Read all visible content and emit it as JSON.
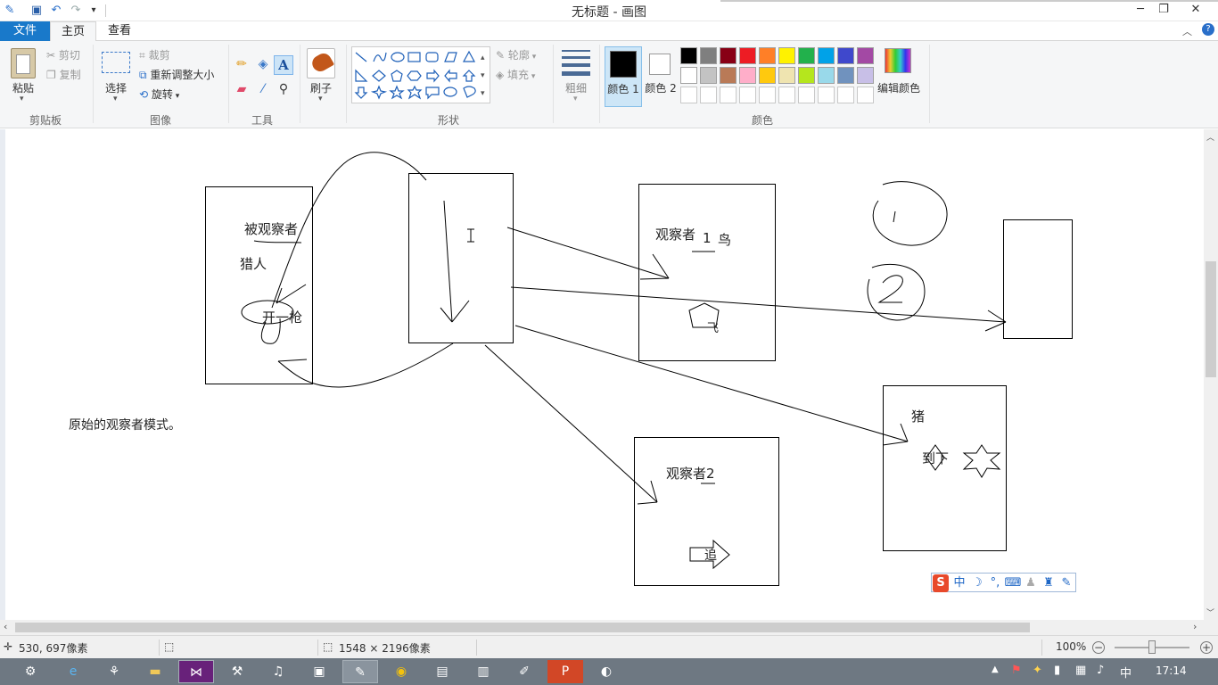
{
  "window": {
    "title": "无标题 - 画图",
    "minimize": "─",
    "restore": "❐",
    "close": "✕"
  },
  "quick_access": [
    "save-icon",
    "undo-icon",
    "redo-icon",
    "customize-icon"
  ],
  "tabs": [
    {
      "label": "文件",
      "active": false
    },
    {
      "label": "主页",
      "active": true
    },
    {
      "label": "查看",
      "active": false
    }
  ],
  "ribbon": {
    "clipboard": {
      "paste": "粘贴",
      "cut": "剪切",
      "copy": "复制",
      "label": "剪贴板"
    },
    "image": {
      "select": "选择",
      "crop": "裁剪",
      "resize": "重新调整大小",
      "rotate": "旋转",
      "label": "图像"
    },
    "tools": {
      "label": "工具"
    },
    "brushes": {
      "label": "刷子"
    },
    "shapes": {
      "outline": "轮廓",
      "fill": "填充",
      "label": "形状"
    },
    "size": {
      "label": "粗细"
    },
    "colors": {
      "color1": "颜色 1",
      "color2": "颜色 2",
      "edit": "编辑颜色",
      "label": "颜色",
      "row1": [
        "#000000",
        "#7f7f7f",
        "#880015",
        "#ed1c24",
        "#ff7f27",
        "#fff200",
        "#22b14c",
        "#00a2e8",
        "#3f48cc",
        "#a349a4"
      ],
      "row2": [
        "#ffffff",
        "#c3c3c3",
        "#b97a57",
        "#ffaec9",
        "#ffc90e",
        "#efe4b0",
        "#b5e61d",
        "#99d9ea",
        "#7092be",
        "#c8bfe7"
      ]
    }
  },
  "canvas": {
    "observed": "被观察者",
    "hunter": "猎人",
    "fire": "开一枪",
    "observer1": "观察者",
    "bird_num": "1",
    "bird": "鸟",
    "fly": "飞",
    "observer2": "观察者2",
    "chase": "追",
    "pig": "猪",
    "fall": "到下",
    "num1": "1",
    "note": "原始的观察者模式。"
  },
  "status": {
    "cursor": "530, 697像素",
    "size": "1548 × 2196像素",
    "zoom": "100%"
  },
  "taskbar": {
    "ime_lang": "中",
    "clock": "17:14"
  },
  "ime_bar": {
    "s": "S",
    "mode": "中"
  }
}
